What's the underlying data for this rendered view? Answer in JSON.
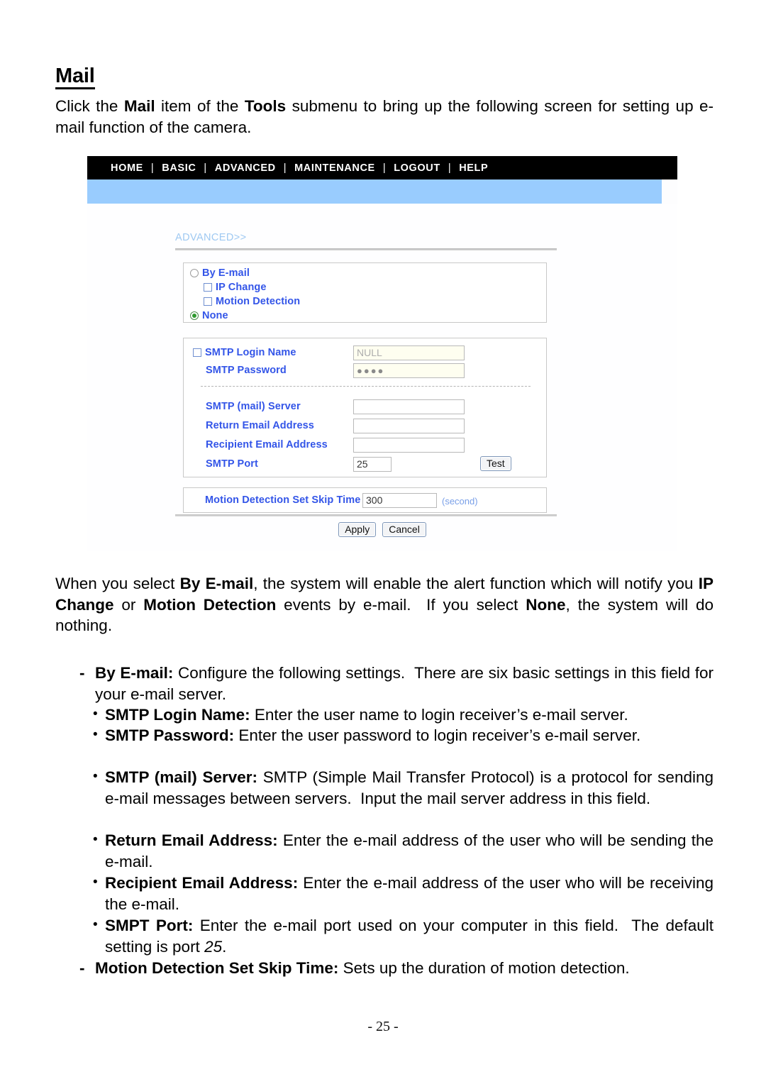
{
  "document": {
    "heading": "Mail",
    "intro_html": "Click the <b>Mail</b> item of the <b>Tools</b> submenu to bring up the following screen for setting up e-mail function of the camera.",
    "when_html": "When you select <b>By E-mail</b>, the system will enable the alert function which will notify you <b>IP Change</b> or <b>Motion Detection</b> events by e-mail.&nbsp; If you select <b>None</b>, the system will do nothing.",
    "footer": "- 25 -"
  },
  "bullets": {
    "by_email_marker": "-",
    "by_email_html": "<b>By E-mail:</b> Configure the following settings.&nbsp; There are six basic settings in this field for your e-mail server.",
    "smtp_login_html": "<b>SMTP Login Name:</b> Enter the user name to login receiver’s e-mail server.",
    "smtp_password_html": "<b>SMTP Password:</b> Enter the user password to login receiver’s e-mail server.",
    "smtp_server_html": "<b>SMTP (mail) Server:</b> SMTP (Simple Mail Transfer Protocol) is a protocol for sending e-mail messages between servers.&nbsp; Input the mail server address in this field.",
    "return_email_html": "<b>Return Email Address:</b> Enter the e-mail address of the user who will be sending the e-mail.",
    "recipient_email_html": "<b>Recipient Email Address:</b> Enter the e-mail address of the user who will be receiving the e-mail.",
    "smpt_port_html": "<b>SMPT Port:</b> Enter the e-mail port used on your computer in this field.&nbsp; The default setting is port <i>25</i>.",
    "motion_skip_marker": "-",
    "motion_skip_html": "<b>Motion Detection Set Skip Time:</b> Sets up the duration of motion detection.",
    "bullet_glyph": "•"
  },
  "screenshot": {
    "nav": {
      "items": [
        "HOME",
        "BASIC",
        "ADVANCED",
        "MAINTENANCE",
        "LOGOUT",
        "HELP"
      ],
      "separator": "|"
    },
    "breadcrumb": "ADVANCED>>",
    "alert_panel": {
      "by_email_label": "By E-mail",
      "by_email_selected": false,
      "ip_change_label": "IP Change",
      "ip_change_checked": false,
      "motion_detection_label": "Motion Detection",
      "motion_detection_checked": false,
      "none_label": "None",
      "none_selected": true
    },
    "smtp_panel": {
      "login_name_label": "SMTP Login Name",
      "login_name_checked": false,
      "login_name_value": "NULL",
      "password_label": "SMTP Password",
      "password_value": "●●●●",
      "server_label": "SMTP (mail) Server",
      "server_value": "",
      "return_email_label": "Return Email Address",
      "return_email_value": "",
      "recipient_email_label": "Recipient Email Address",
      "recipient_email_value": "",
      "port_label": "SMTP Port",
      "port_value": "25",
      "test_button": "Test"
    },
    "skip_panel": {
      "label": "Motion Detection Set Skip Time",
      "value": "300",
      "unit": "(second)"
    },
    "buttons": {
      "apply": "Apply",
      "cancel": "Cancel"
    },
    "colors": {
      "nav_bg": "#000000",
      "nav_text": "#ffffff",
      "accent_bar": "#99ccfe",
      "label_blue": "#3355e8",
      "breadcrumb_blue": "#9fc9f2",
      "radio_on": "#2f9a2f"
    }
  }
}
